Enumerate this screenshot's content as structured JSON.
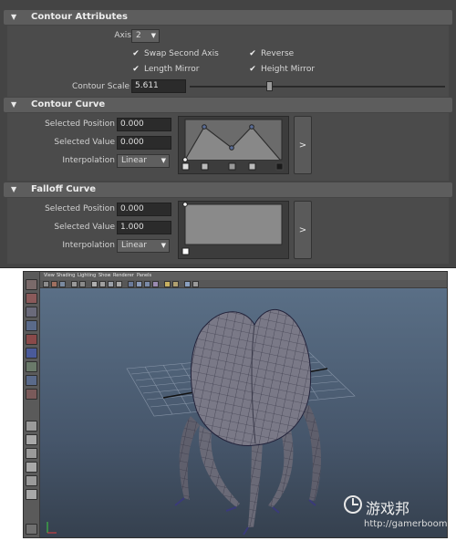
{
  "attribute_editor": {
    "contour_attributes": {
      "header": "Contour Attributes",
      "axis_label": "Axis",
      "axis_value": "2",
      "checkboxes": [
        {
          "label": "Swap Second Axis",
          "checked": true
        },
        {
          "label": "Reverse",
          "checked": true
        },
        {
          "label": "Length Mirror",
          "checked": true
        },
        {
          "label": "Height Mirror",
          "checked": true
        }
      ],
      "contour_scale_label": "Contour Scale",
      "contour_scale_value": "5.611",
      "slider_fraction": 0.31
    },
    "contour_curve": {
      "header": "Contour Curve",
      "selected_position_label": "Selected Position",
      "selected_position_value": "0.000",
      "selected_value_label": "Selected Value",
      "selected_value_value": "0.000",
      "interpolation_label": "Interpolation",
      "interpolation_value": "Linear",
      "expand_button": ">"
    },
    "falloff_curve": {
      "header": "Falloff Curve",
      "selected_position_label": "Selected Position",
      "selected_position_value": "0.000",
      "selected_value_label": "Selected Value",
      "selected_value_value": "1.000",
      "interpolation_label": "Interpolation",
      "interpolation_value": "Linear",
      "expand_button": ">"
    }
  },
  "viewport_panel": {
    "menu": [
      "View",
      "Shading",
      "Lighting",
      "Show",
      "Renderer",
      "Panels"
    ]
  },
  "watermark": {
    "brand": "游戏邦",
    "url": "http://gamerboom.com"
  },
  "colors": {
    "panel_bg": "#444444",
    "header_bg": "#5d5d5d",
    "field_bg": "#2b2b2b",
    "viewport_sky": "#5a6f86",
    "mesh": "#6d6c78",
    "wire": "#2b2b3c"
  }
}
